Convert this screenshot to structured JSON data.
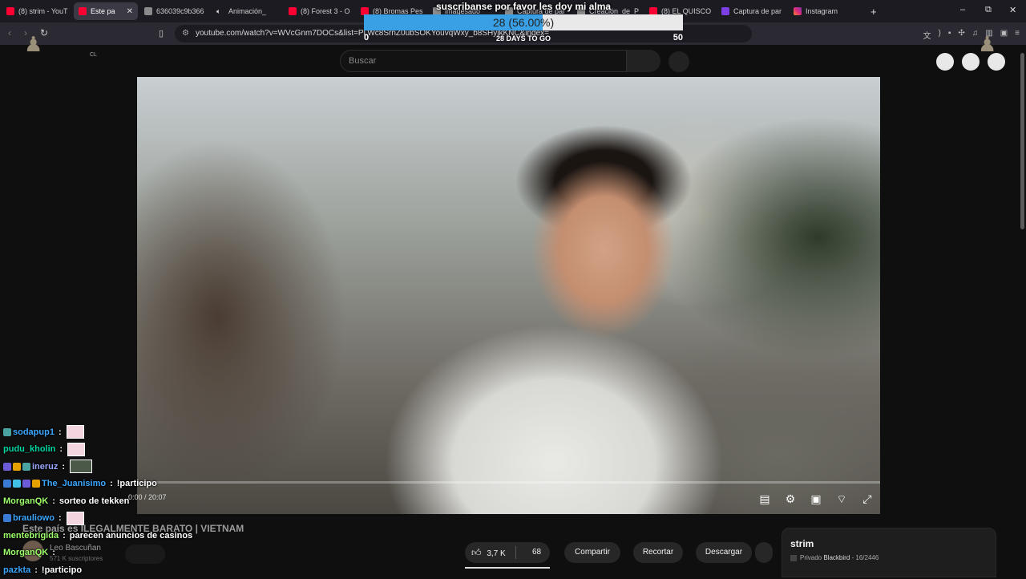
{
  "browser": {
    "tabs": [
      {
        "label": "(8) strim - YouT",
        "favicon": "youtube-icon"
      },
      {
        "label": "Este pa",
        "favicon": "youtube-icon",
        "active": true
      },
      {
        "label": "636039c9b366",
        "favicon": "generic-icon"
      },
      {
        "label": "Animación_",
        "favicon": "speaker-icon"
      },
      {
        "label": "(8) Forest 3 - O",
        "favicon": "youtube-icon"
      },
      {
        "label": "(8) Bromas Pes",
        "favicon": "youtube-icon"
      },
      {
        "label": "imagesado",
        "favicon": "generic-icon"
      },
      {
        "label": "Captura de par",
        "favicon": "generic-icon"
      },
      {
        "label": "Creación_de_P",
        "favicon": "generic-icon"
      },
      {
        "label": "(8) EL QUISCO",
        "favicon": "youtube-icon"
      },
      {
        "label": "Captura de par",
        "favicon": "pen-icon"
      },
      {
        "label": "Instagram",
        "favicon": "instagram-icon"
      }
    ],
    "new_tab": "+",
    "url": "youtube.com/watch?v=WVcGnm7DOCs&list=PLWc8SrnZ0ubSOKYouvqWxy_b8SHyikKNC&index=",
    "window_controls": {
      "minimize": "–",
      "maximize": "⧉",
      "close": "✕"
    }
  },
  "goal_overlay": {
    "title": "suscribanse por favor les doy mi alma",
    "progress_text": "28 (56.00%)",
    "progress_fraction": 0.56,
    "min": "0",
    "max": "50",
    "days_left": "28 DAYS TO GO"
  },
  "youtube": {
    "logo_text": "CL",
    "search_placeholder": "Buscar",
    "player": {
      "timecode": "0:00 / 20:07",
      "progress_fraction": 0.0
    },
    "video_title": "Este país es ILEGALMENTE BARATO | VIETNAM",
    "channel": {
      "name": "Leo Bascuñan",
      "subscribers": "571 K suscriptores"
    },
    "actions": {
      "likes": "3,7 K",
      "comments": "68",
      "share": "Compartir",
      "clip": "Recortar",
      "download": "Descargar"
    },
    "playlist": {
      "title": "strim",
      "privacy": "Privado",
      "owner": "Blackbird",
      "position": "16/2446"
    }
  },
  "chat": [
    {
      "user": "sodapup1",
      "color": "#3ba7ff",
      "message": "",
      "emote": true,
      "badges": [
        "#4aa3a0"
      ]
    },
    {
      "user": "pudu_kholin",
      "color": "#00d6a4",
      "message": "",
      "emote": true,
      "badges": []
    },
    {
      "user": "ineruz",
      "color": "#9aa6ff",
      "message": "",
      "emote": true,
      "emote_dark": true,
      "badges": [
        "#6b5bd6",
        "#e5a100",
        "#4aa3a0"
      ]
    },
    {
      "user": "The_Juanisimo",
      "color": "#3ba7ff",
      "message": "!participo",
      "emote": false,
      "badges": [
        "#3a7bd5",
        "#41c1e8",
        "#6b5bd6",
        "#e5a100"
      ]
    },
    {
      "user": "MorganQK",
      "color": "#9dff6a",
      "message": "sorteo de tekken",
      "emote": false,
      "badges": []
    },
    {
      "user": "brauliowo",
      "color": "#3ba7ff",
      "message": "",
      "emote": true,
      "badges": [
        "#3a7bd5"
      ]
    },
    {
      "user": "mentebrigida",
      "color": "#9dff6a",
      "message": "parecen anuncios de casinos",
      "emote": false,
      "badges": []
    },
    {
      "user": "MorganQK",
      "color": "#9dff6a",
      "message": "",
      "emote": false,
      "badges": []
    },
    {
      "user": "pazkta",
      "color": "#3ba7ff",
      "message": "!participo",
      "emote": false,
      "badges": []
    }
  ],
  "colors": {
    "youtube_red": "#ff0033",
    "goal_fill": "#3aa0e6",
    "background": "#0f0f0f"
  }
}
